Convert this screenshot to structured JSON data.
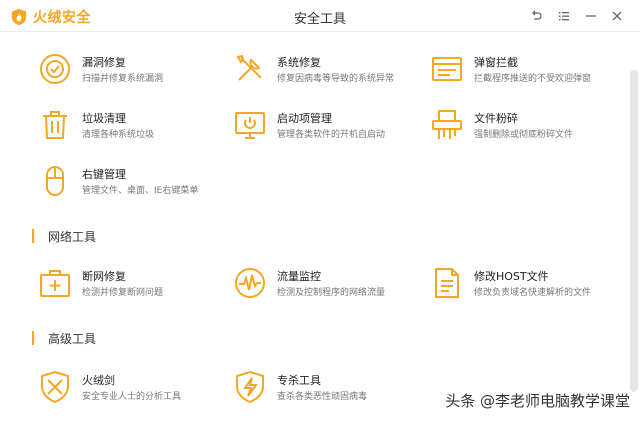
{
  "app": {
    "logo_text": "火绒安全",
    "window_title": "安全工具"
  },
  "theme": {
    "accent": "#f5a623",
    "bg": "#ffffff"
  },
  "window_controls": [
    "back-icon",
    "menu-icon",
    "minimize-icon",
    "close-icon"
  ],
  "system_tools": [
    {
      "icon": "shield-repair-icon",
      "name": "漏洞修复",
      "desc": "扫描并修复系统漏洞"
    },
    {
      "icon": "wrench-screwdriver-icon",
      "name": "系统修复",
      "desc": "修复因病毒等导致的系统异常"
    },
    {
      "icon": "window-popup-icon",
      "name": "弹窗拦截",
      "desc": "拦截程序推送的不受欢迎弹窗"
    },
    {
      "icon": "trash-icon",
      "name": "垃圾清理",
      "desc": "清理各种系统垃圾"
    },
    {
      "icon": "monitor-power-icon",
      "name": "启动项管理",
      "desc": "管理各类软件的开机自启动"
    },
    {
      "icon": "shredder-icon",
      "name": "文件粉碎",
      "desc": "强制删除或彻底粉碎文件"
    },
    {
      "icon": "mouse-icon",
      "name": "右键管理",
      "desc": "管理文件、桌面、IE右键菜单"
    }
  ],
  "network_section": {
    "title": "网络工具",
    "tools": [
      {
        "icon": "first-aid-kit-icon",
        "name": "断网修复",
        "desc": "检测并修复断网问题"
      },
      {
        "icon": "traffic-monitor-icon",
        "name": "流量监控",
        "desc": "检测及控制程序的网络流量"
      },
      {
        "icon": "hosts-file-icon",
        "name": "修改HOST文件",
        "desc": "修改负责域名快速解析的文件"
      }
    ]
  },
  "advanced_section": {
    "title": "高级工具",
    "tools": [
      {
        "icon": "sword-shield-icon",
        "name": "火绒剑",
        "desc": "安全专业人士的分析工具"
      },
      {
        "icon": "lightning-shield-icon",
        "name": "专杀工具",
        "desc": "查杀各类恶性顽固病毒"
      }
    ]
  },
  "watermark": "头条 @李老师电脑教学课堂"
}
